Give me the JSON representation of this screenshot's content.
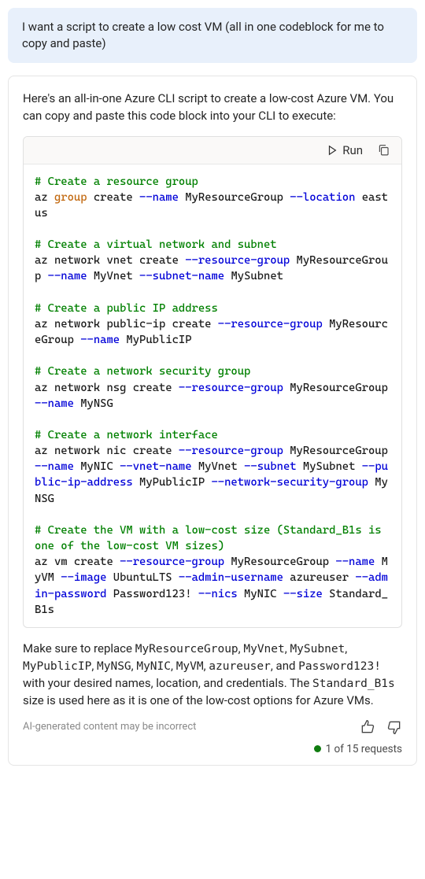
{
  "user_message": "I want a script to create a low cost VM (all in one codeblock for me to copy and paste)",
  "intro": "Here's an all-in-one Azure CLI script to create a low-cost Azure VM. You can copy and paste this code block into your CLI to execute:",
  "code_header": {
    "run_label": "Run"
  },
  "code": {
    "c1": "# Create a resource group",
    "l1a": "az ",
    "l1kw": "group",
    "l1b": " create ",
    "l1f1": "--name",
    "l1c": " MyResourceGroup ",
    "l1f2": "--location",
    "l1d": " eastus",
    "c2": "# Create a virtual network and subnet",
    "l2a": "az network vnet create ",
    "l2f1": "--resource-group",
    "l2b": " MyResourceGroup ",
    "l2f2": "--name",
    "l2c": " MyVnet ",
    "l2f3": "--subnet-name",
    "l2d": " MySubnet",
    "c3": "# Create a public IP address",
    "l3a": "az network public-ip create ",
    "l3f1": "--resource-group",
    "l3b": " MyResourceGroup ",
    "l3f2": "--name",
    "l3c": " MyPublicIP",
    "c4": "# Create a network security group",
    "l4a": "az network nsg create ",
    "l4f1": "--resource-group",
    "l4b": " MyResourceGroup ",
    "l4f2": "--name",
    "l4c": " MyNSG",
    "c5": "# Create a network interface",
    "l5a": "az network nic create ",
    "l5f1": "--resource-group",
    "l5b": " MyResourceGroup ",
    "l5f2": "--name",
    "l5c": " MyNIC ",
    "l5f3": "--vnet-name",
    "l5d": " MyVnet ",
    "l5f4": "--subnet",
    "l5e": " MySubnet ",
    "l5f5": "--public-ip-address",
    "l5g": " MyPublicIP ",
    "l5f6": "--network-security-group",
    "l5h": " MyNSG",
    "c6": "# Create the VM with a low-cost size (Standard_B1s is one of the low-cost VM sizes)",
    "l6a": "az vm create ",
    "l6f1": "--resource-group",
    "l6b": " MyResourceGroup ",
    "l6f2": "--name",
    "l6c": " MyVM ",
    "l6f3": "--image",
    "l6d": " UbuntuLTS ",
    "l6f4": "--admin-username",
    "l6e": " azureuser ",
    "l6f5": "--admin-password",
    "l6g": " Password123! ",
    "l6f6": "--nics",
    "l6h": " MyNIC ",
    "l6f7": "--size",
    "l6i": " Standard_B1s"
  },
  "outro": {
    "t1": "Make sure to replace ",
    "m1": "MyResourceGroup",
    "s1": ", ",
    "m2": "MyVnet",
    "s2": ", ",
    "m3": "MySubnet",
    "s3": ", ",
    "m4": "MyPublicIP",
    "s4": ", ",
    "m5": "MyNSG",
    "s5": ", ",
    "m6": "MyNIC",
    "s6": ", ",
    "m7": "MyVM",
    "s7": ", ",
    "m8": "azureuser",
    "s8": ", and ",
    "m9": "Password123!",
    "t2": " with your desired names, location, and credentials. The ",
    "m10": "Standard_B1s",
    "t3": " size is used here as it is one of the low-cost options for Azure VMs."
  },
  "disclaimer": "AI-generated content may be incorrect",
  "requests_status": "1 of 15 requests"
}
